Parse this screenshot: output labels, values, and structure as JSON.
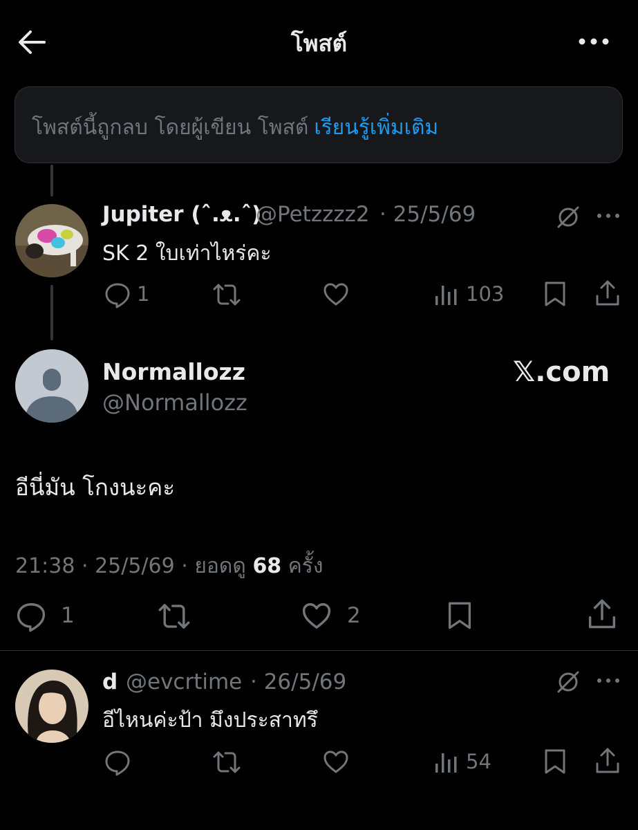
{
  "header": {
    "title": "โพสต์",
    "back_icon": "back-arrow-icon",
    "more_icon": "more-horizontal-icon"
  },
  "notice": {
    "text": "โพสต์นี้ถูกลบ โดยผู้เขียน โพสต์",
    "link": "เรียนรู้เพิ่มเติม"
  },
  "reply1": {
    "name": "Jupiter (ˆ.ᴥ.ˆ)",
    "handle": "@Petzzzz2",
    "date": "· 25/5/69",
    "text": "SK 2 ใบเท่าไหร่คะ",
    "replies": "1",
    "views": "103"
  },
  "main": {
    "name": "Normallozz",
    "handle": "@Normallozz",
    "watermark": "𝕏.com",
    "text": "อีนี่มัน โกงนะคะ",
    "time": "21:38 · 25/5/69 · ยอดดู",
    "views": "68",
    "views_suffix": "ครั้ง",
    "replies": "1",
    "likes": "2"
  },
  "reply2": {
    "name": "d",
    "handle": "@evcrtime",
    "date": "· 26/5/69",
    "text": "อีไหนค่ะป้า มึงประสาทรึ",
    "views": "54"
  },
  "colors": {
    "background": "#000000",
    "text": "#e7e9ea",
    "muted": "#71767b",
    "link": "#1d9bf0"
  }
}
